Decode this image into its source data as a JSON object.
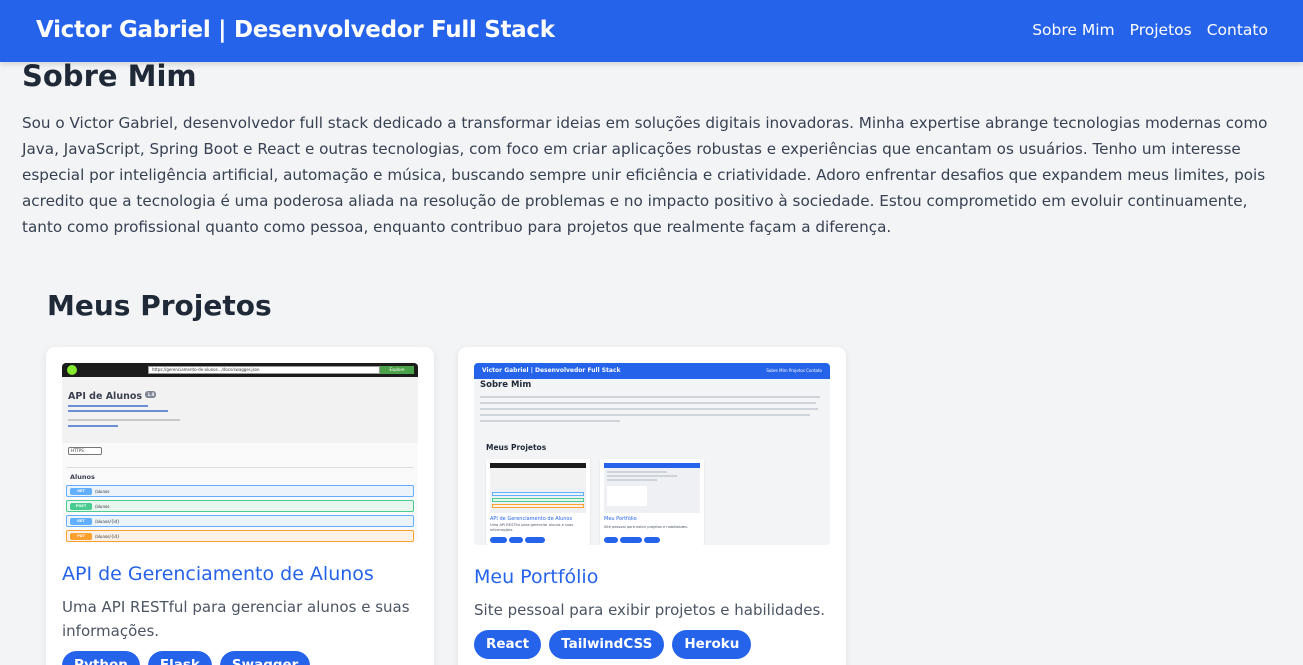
{
  "header": {
    "brand": "Victor Gabriel | Desenvolvedor Full Stack",
    "nav": [
      "Sobre Mim",
      "Projetos",
      "Contato"
    ]
  },
  "about": {
    "title": "Sobre Mim",
    "text": "Sou o Victor Gabriel, desenvolvedor full stack dedicado a transformar ideias em soluções digitais inovadoras. Minha expertise abrange tecnologias modernas como Java, JavaScript, Spring Boot e React e outras tecnologias, com foco em criar aplicações robustas e experiências que encantam os usuários. Tenho um interesse especial por inteligência artificial, automação e música, buscando sempre unir eficiência e criatividade. Adoro enfrentar desafios que expandem meus limites, pois acredito que a tecnologia é uma poderosa aliada na resolução de problemas e no impacto positivo à sociedade. Estou comprometido em evoluir continuamente, tanto como profissional quanto como pessoa, enquanto contribuo para projetos que realmente façam a diferença."
  },
  "projects": {
    "title": "Meus Projetos",
    "items": [
      {
        "title": "API de Gerenciamento de Alunos",
        "description": "Uma API RESTful para gerenciar alunos e suas informações.",
        "tags": [
          "Python",
          "Flask",
          "Swagger"
        ],
        "thumbnail": {
          "url": "https://gerenciamento-de-alunos.../docs/swagger.json",
          "explore": "Explore",
          "api_title": "API de Alunos",
          "version": "1.0",
          "schemes": "HTTPS",
          "section": "Alunos",
          "operations": [
            {
              "method": "GET",
              "path": "/alunos",
              "color": "#61affe",
              "bg": "#ebf3fb"
            },
            {
              "method": "POST",
              "path": "/alunos",
              "color": "#49cc90",
              "bg": "#e8f6f0"
            },
            {
              "method": "GET",
              "path": "/alunos/{id}",
              "color": "#61affe",
              "bg": "#ebf3fb"
            },
            {
              "method": "PUT",
              "path": "/alunos/{id}",
              "color": "#fca130",
              "bg": "#fbf1e6"
            }
          ]
        }
      },
      {
        "title": "Meu Portfólio",
        "description": "Site pessoal para exibir projetos e habilidades.",
        "tags": [
          "React",
          "TailwindCSS",
          "Heroku"
        ],
        "thumbnail": {
          "brand": "Victor Gabriel | Desenvolvedor Full Stack",
          "nav": "Sobre Mim   Projetos   Contato",
          "about_title": "Sobre Mim",
          "projects_title": "Meus Projetos",
          "card_1_title": "API de Gerenciamento de Alunos",
          "card_1_desc": "Uma API RESTful para gerenciar alunos e suas",
          "card_1_desc2": "informações.",
          "card_2_title": "Meu Portfólio",
          "card_2_desc": "Site pessoal para exibir projetos e habilidades."
        }
      }
    ]
  },
  "colors": {
    "primary": "#2563eb",
    "background": "#f3f4f6"
  }
}
